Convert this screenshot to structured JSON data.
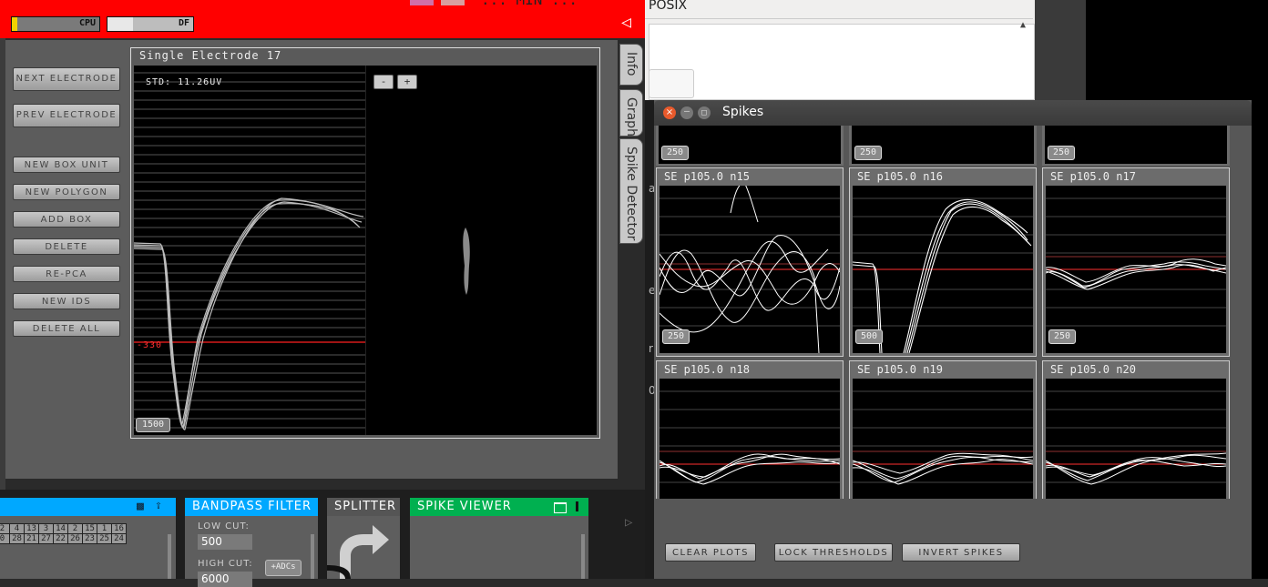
{
  "topbar": {
    "cpu_label": "CPU",
    "df_label": "DF",
    "partial_text": "...  MIN  ...",
    "back_icon": "◁",
    "color": "#ff0000"
  },
  "editor": {
    "buttons": [
      "NEXT ELECTRODE",
      "PREV ELECTRODE",
      "NEW BOX UNIT",
      "NEW POLYGON",
      "ADD BOX",
      "DELETE",
      "RE-PCA",
      "NEW IDS",
      "DELETE ALL"
    ],
    "plot_title": "Single Electrode 17",
    "std_text": "STD: 11.26UV",
    "threshold_label": "-330",
    "scale_label": "1500",
    "zoom_out": "-",
    "zoom_in": "+",
    "tabs": [
      "Info",
      "Graph",
      "Spike Detector"
    ]
  },
  "bottom": {
    "blue_panel_icons": [
      "save-icon",
      "upload-icon"
    ],
    "channel_grid": [
      [
        "2",
        "4",
        "13",
        "3",
        "14",
        "2",
        "15",
        "1",
        "16"
      ],
      [
        "0",
        "28",
        "21",
        "27",
        "22",
        "26",
        "23",
        "25",
        "24"
      ]
    ],
    "bandpass": {
      "title": "BANDPASS FILTER",
      "low_label": "LOW CUT:",
      "low_value": "500",
      "high_label": "HIGH CUT:",
      "high_value": "6000",
      "adcs_button": "+ADCs"
    },
    "splitter": {
      "title": "SPLITTER"
    },
    "spike_viewer": {
      "title": "SPIKE VIEWER"
    },
    "play_icon": "▷"
  },
  "posix_window": {
    "title": "POSIX"
  },
  "spikes_window": {
    "title": "Spikes",
    "top_row_scales": [
      "250",
      "250",
      "250"
    ],
    "cells": [
      {
        "label": "SE   p105.0 n15",
        "scale": "250"
      },
      {
        "label": "SE   p105.0 n16",
        "scale": "500"
      },
      {
        "label": "SE   p105.0 n17",
        "scale": "250"
      },
      {
        "label": "SE   p105.0 n18",
        "scale": ""
      },
      {
        "label": "SE   p105.0 n19",
        "scale": ""
      },
      {
        "label": "SE   p105.0 n20",
        "scale": ""
      }
    ],
    "buttons": [
      "CLEAR PLOTS",
      "LOCK THRESHOLDS",
      "INVERT SPIKES"
    ]
  },
  "background_letters": [
    "a",
    "e",
    "r",
    "0"
  ]
}
